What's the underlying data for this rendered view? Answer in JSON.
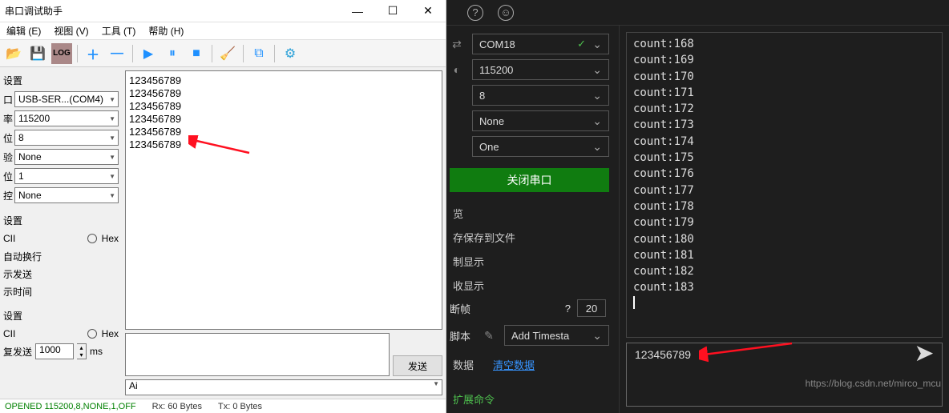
{
  "left": {
    "title": "串口调试助手",
    "menu": {
      "edit": "编辑 (E)",
      "view": "视图 (V)",
      "tools": "工具 (T)",
      "help": "帮助 (H)"
    },
    "side": {
      "group1": "设置",
      "port_lbl": "口",
      "port": "USB-SER...(COM4)",
      "baud_lbl": "率",
      "baud": "115200",
      "data_lbl": "位",
      "databits": "8",
      "parity_lbl": "验",
      "parity": "None",
      "stop_lbl": "位",
      "stopbits": "1",
      "flow_lbl": "控",
      "flow": "None",
      "group2": "设置",
      "ascii": "CII",
      "hex": "Hex",
      "autowrap": "自动换行",
      "showsend": "示发送",
      "showtime": "示时间",
      "group3": "设置",
      "ascii2": "CII",
      "hex2": "Hex",
      "repeat": "复发送",
      "repeat_ms": "1000",
      "ms": "ms"
    },
    "rx": "123456789\n123456789\n123456789\n123456789\n123456789\n123456789",
    "send": "发送",
    "bottom_sel": "Ai",
    "status": {
      "a": "OPENED 115200,8,NONE,1,OFF",
      "b": "Rx: 60 Bytes",
      "c": "Tx: 0 Bytes"
    }
  },
  "right": {
    "port": "COM18",
    "baud": "115200",
    "databits": "8",
    "parity": "None",
    "stopbits": "One",
    "close": "关闭串口",
    "opts": {
      "a": "览",
      "b": "存保存到文件",
      "c": "制显示",
      "d": "收显示",
      "e": "断帧",
      "f": "脚本"
    },
    "frame_q": "?",
    "frame_n": "20",
    "addts": "Add Timesta",
    "links": {
      "data": "数据",
      "clear": "清空数据",
      "ext": "扩展命令"
    },
    "monitor": [
      "count:168",
      "count:169",
      "count:170",
      "count:171",
      "count:172",
      "count:173",
      "count:174",
      "count:175",
      "count:176",
      "count:177",
      "count:178",
      "count:179",
      "count:180",
      "count:181",
      "count:182",
      "count:183"
    ],
    "input": "123456789",
    "watermark": "https://blog.csdn.net/mirco_mcu"
  }
}
